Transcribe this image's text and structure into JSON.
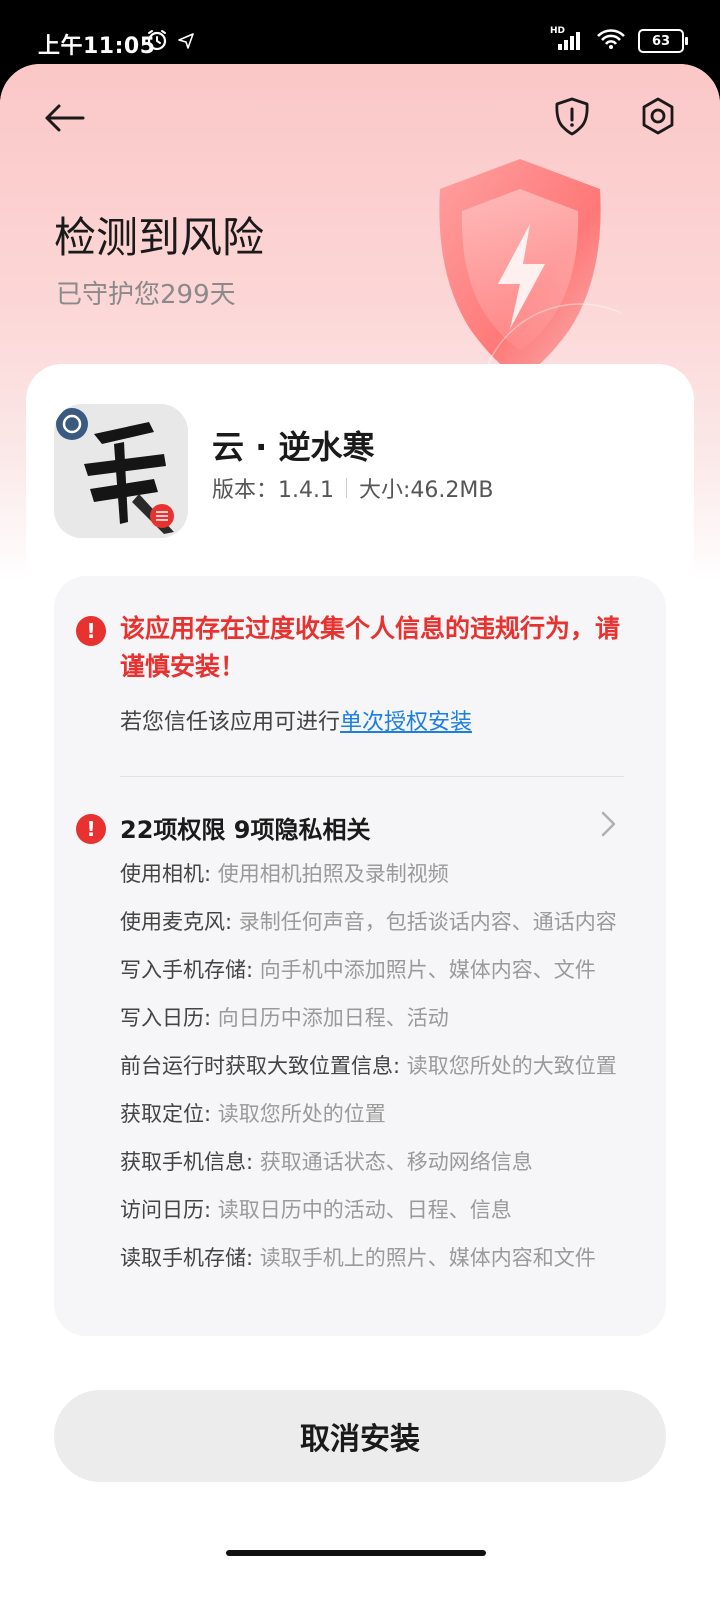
{
  "status_bar": {
    "time": "上午11:05",
    "network": "HD",
    "battery": "63"
  },
  "header": {
    "title": "检测到风险",
    "subtitle": "已守护您299天"
  },
  "app": {
    "name": "云 · 逆水寒",
    "version": "版本：1.4.1",
    "size": "大小:46.2MB"
  },
  "warning": {
    "icon": "!",
    "message": "该应用存在过度收集个人信息的违规行为，请谨慎安装！",
    "trust_prefix": "若您信任该应用可进行",
    "trust_link": "单次授权安装"
  },
  "permissions": {
    "icon": "!",
    "summary": "22项权限 9项隐私相关",
    "items": [
      {
        "name": "使用相机:",
        "desc": "使用相机拍照及录制视频"
      },
      {
        "name": "使用麦克风:",
        "desc": "录制任何声音，包括谈话内容、通话内容"
      },
      {
        "name": "写入手机存储:",
        "desc": "向手机中添加照片、媒体内容、文件"
      },
      {
        "name": "写入日历:",
        "desc": "向日历中添加日程、活动"
      },
      {
        "name": "前台运行时获取大致位置信息:",
        "desc": "读取您所处的大致位置"
      },
      {
        "name": "获取定位:",
        "desc": "读取您所处的位置"
      },
      {
        "name": "获取手机信息:",
        "desc": "获取通话状态、移动网络信息"
      },
      {
        "name": "访问日历:",
        "desc": "读取日历中的活动、日程、信息"
      },
      {
        "name": "读取手机存储:",
        "desc": "读取手机上的照片、媒体内容和文件"
      }
    ]
  },
  "actions": {
    "cancel_label": "取消安装"
  },
  "colors": {
    "warning_red": "#e8322f",
    "link_blue": "#1a7fe0",
    "header_pink": "#fbc7c7"
  }
}
